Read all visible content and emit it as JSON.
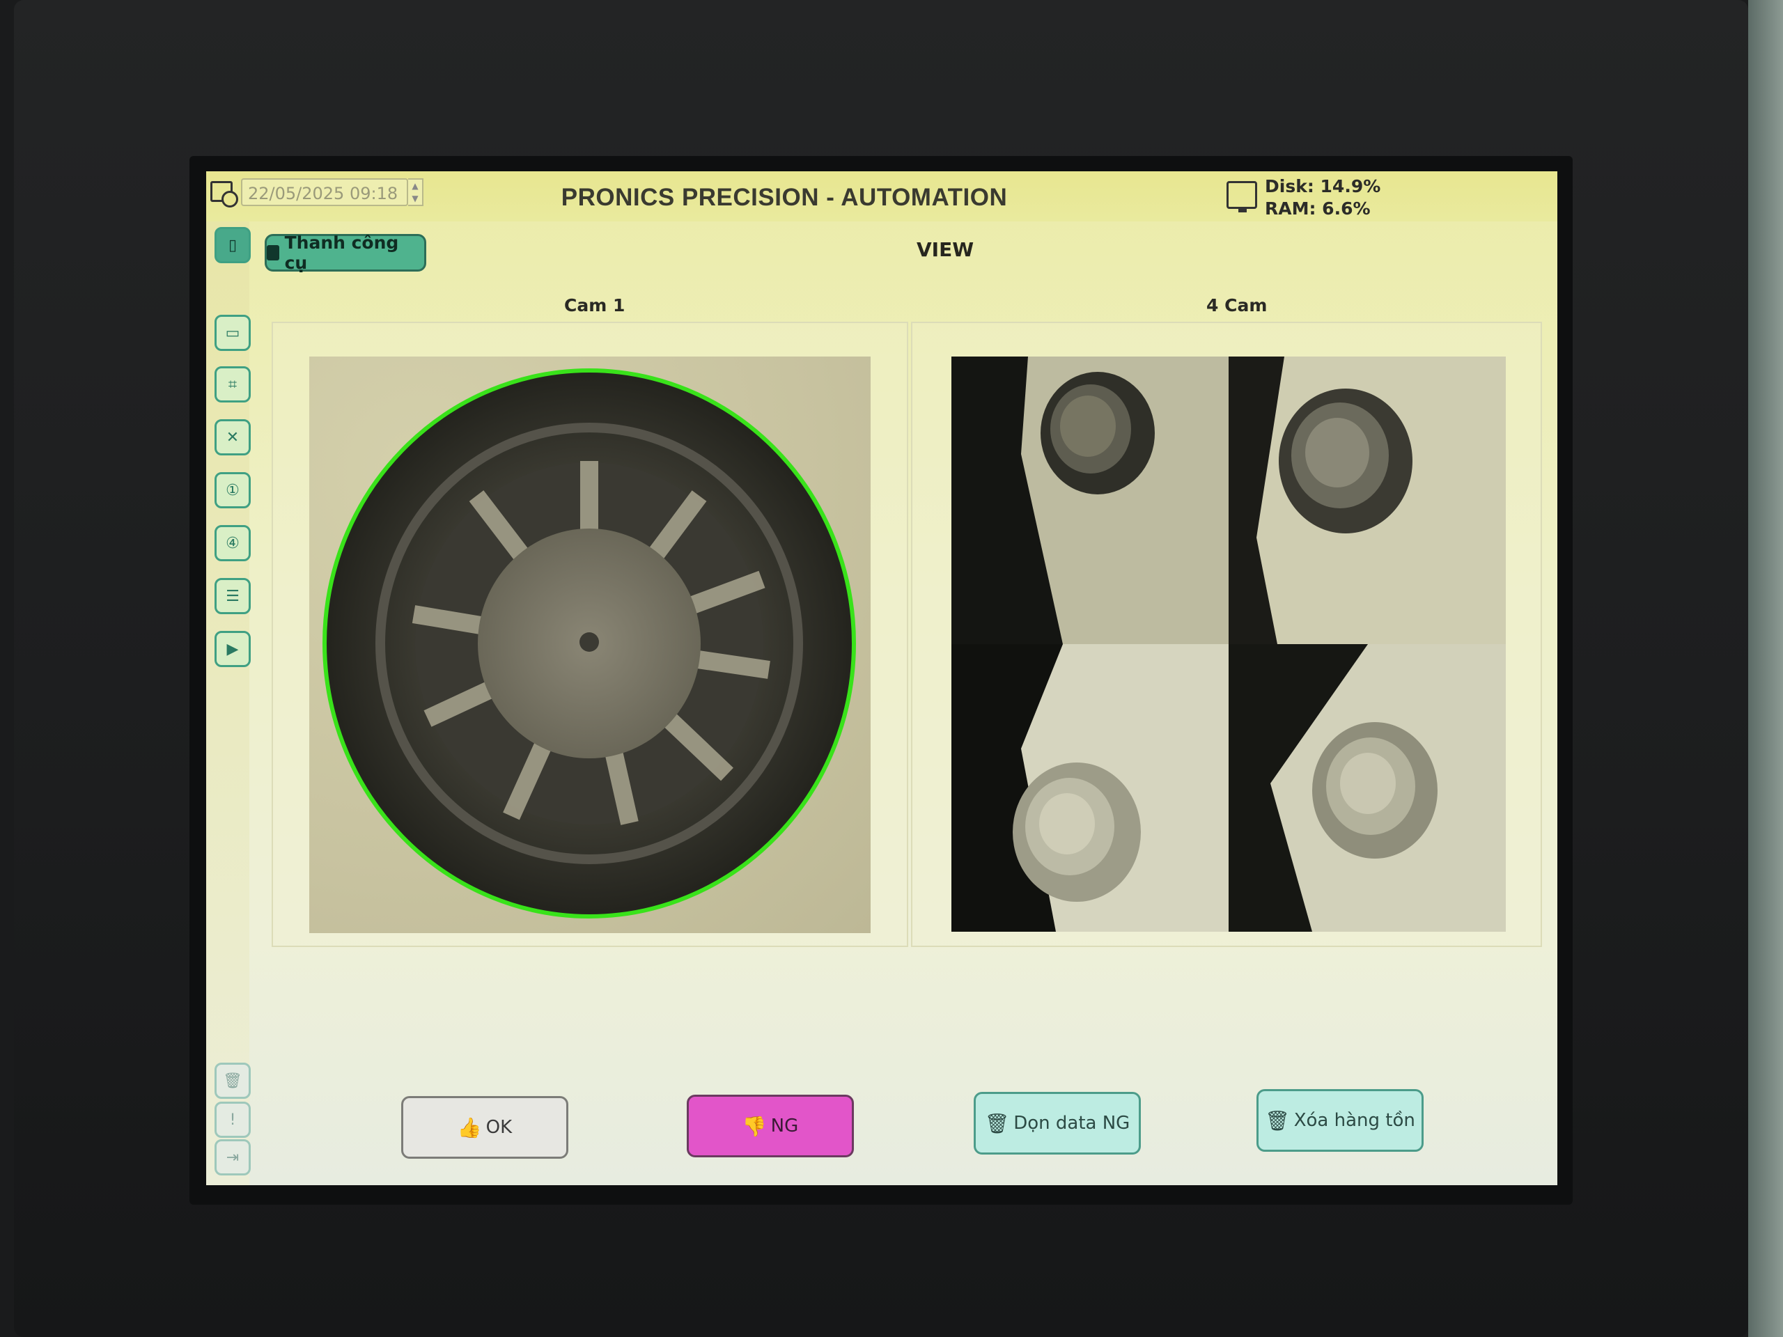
{
  "header": {
    "datetime": "22/05/2025 09:18",
    "title": "PRONICS PRECISION - AUTOMATION",
    "disk": "Disk: 14.9%",
    "ram": "RAM: 6.6%"
  },
  "toolbar": {
    "tools_label": "Thanh công cụ",
    "view_title": "VIEW"
  },
  "cameras": {
    "cam1_label": "Cam 1",
    "cam4_label": "4 Cam"
  },
  "actions": {
    "ok_label": "OK",
    "ng_label": "NG",
    "clean_ng_label": "Dọn data NG",
    "clear_stock_label": "Xóa hàng tồn"
  },
  "sidebar": {
    "icons": [
      "phone-icon",
      "monitor-icon",
      "capture-icon",
      "collapse-icon",
      "camera-1-icon",
      "camera-4-icon",
      "list-icon",
      "media-icon",
      "trash-icon",
      "alert-icon",
      "exit-icon"
    ]
  },
  "colors": {
    "screen_bg": "#eef0c8",
    "accent_green": "#4fb38e",
    "ng_pink": "#e255c9",
    "detect_outline": "#39e21a"
  }
}
